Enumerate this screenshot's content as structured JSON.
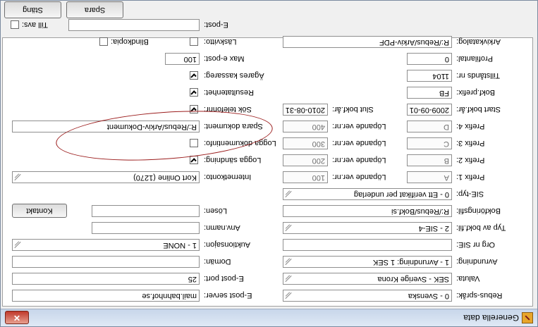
{
  "window": {
    "title": "Generella data",
    "close_glyph": "✕"
  },
  "buttons": {
    "save": "Spara",
    "close": "Stäng",
    "contact": "Kontakt"
  },
  "left_fields": [
    {
      "label": "Rebus-språk:",
      "value": "0     - Svenska",
      "type": "dropdown"
    },
    {
      "label": "Valuta:",
      "value": "SEK  - Sverige Krona",
      "type": "dropdown"
    },
    {
      "label": "Avrundning:",
      "value": "1     - Avrundning: 1 SEK",
      "type": "dropdown"
    },
    {
      "label": "Org nr SIE:",
      "value": "",
      "type": "text"
    },
    {
      "label": "Typ av bokf.fil:",
      "value": "2     - SIE-4",
      "type": "dropdown"
    },
    {
      "label": "Bokföringsfil:",
      "value": "R:/Rebus/Bokf.si",
      "type": "text"
    },
    {
      "label": "SIE-typ:",
      "value": "0     - Ett verifikat per underlag",
      "type": "dropdown"
    },
    {
      "label": "Prefix 1:",
      "value": "A",
      "type": "text"
    },
    {
      "label": "Prefix 2:",
      "value": "B",
      "type": "text"
    },
    {
      "label": "Prefix 3:",
      "value": "C",
      "type": "text"
    },
    {
      "label": "Prefix 4:",
      "value": "D",
      "type": "text"
    },
    {
      "label": "Start bokf.år:",
      "value": "2009-09-01",
      "type": "text"
    },
    {
      "label": "Bokf.prefix:",
      "value": "FB",
      "type": "text"
    },
    {
      "label": "Tillstånds nr:",
      "value": "1104",
      "type": "text"
    },
    {
      "label": "Profilantal:",
      "value": "0",
      "type": "text"
    },
    {
      "label": "Arkivkatalog:",
      "value": "R:/Rebus/Arkiv-PDF",
      "type": "text"
    }
  ],
  "middle_fields": [
    {
      "label": "Löpande ver.nr:",
      "value": "100"
    },
    {
      "label": "Löpande ver.nr:",
      "value": "200"
    },
    {
      "label": "Löpande ver.nr:",
      "value": "300"
    },
    {
      "label": "Löpande ver.nr:",
      "value": "400"
    },
    {
      "label": "Slut bokf.år:",
      "value": "2010-08-31"
    }
  ],
  "right_fields": {
    "email_server": {
      "label": "E-post server:",
      "value": "mail.bahnhof.se"
    },
    "email_port": {
      "label": "E-post port:",
      "value": "25"
    },
    "domain": {
      "label": "Domän:",
      "value": ""
    },
    "auction_site": {
      "label": "Auktionsajon:",
      "value": "1     - NONE"
    },
    "username": {
      "label": "Anv.namn:",
      "value": ""
    },
    "password": {
      "label": "Lösen:",
      "value": ""
    },
    "internet_account": {
      "label": "Internetkonto:",
      "value": "Kort Online (1270)"
    },
    "log_sending": {
      "label": "Logga sändning:",
      "checked": true
    },
    "log_doc_info": {
      "label": "Logga dokumentinfo:",
      "checked": false
    },
    "save_documents": {
      "label": "Spara dokument:",
      "value": "R:/Rebus/Arkiv-Dokument"
    },
    "search_phone": {
      "label": "Sök telefonnr:",
      "checked": true
    },
    "result_units": {
      "label": "Resultatenhet:",
      "checked": true
    },
    "own_registers": {
      "label": "Ägares kassareg:",
      "checked": true
    },
    "max_email": {
      "label": "Max e-post:",
      "value": "100"
    },
    "read_receipt": {
      "label": "Läskvitto:",
      "checked": false
    },
    "blind_copy": {
      "label": "Blindkopia:",
      "checked": false
    },
    "email": {
      "label": "E-post:",
      "value": ""
    },
    "to_sender": {
      "label": "Till avs:",
      "checked": false
    }
  },
  "colors": {
    "annotation": "#9b1c1c",
    "titlebar": "#c7d6ea",
    "close": "#c0392b"
  }
}
